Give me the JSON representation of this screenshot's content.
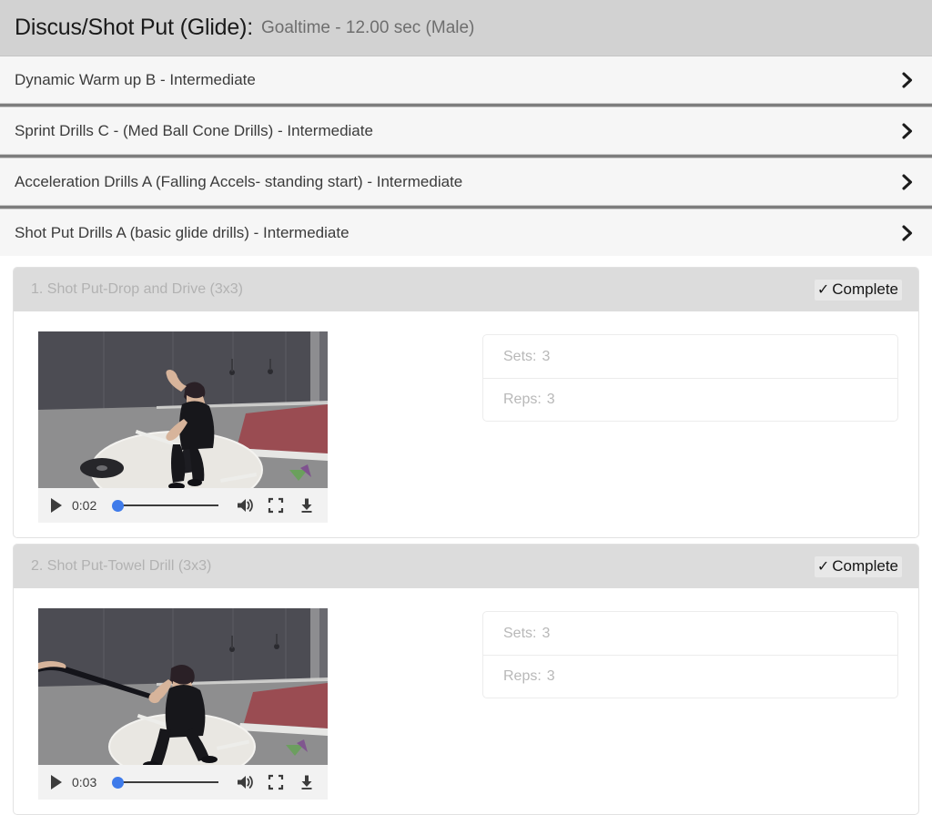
{
  "header": {
    "title": "Discus/Shot Put (Glide):",
    "subtitle": "Goaltime - 12.00 sec (Male)"
  },
  "accordion": {
    "items": [
      {
        "label": "Dynamic Warm up B - Intermediate",
        "icon": "chevron-right-icon"
      },
      {
        "label": "Sprint Drills C - (Med Ball Cone Drills) - Intermediate",
        "icon": "chevron-right-icon"
      },
      {
        "label": "Acceleration Drills A (Falling Accels- standing start) - Intermediate",
        "icon": "chevron-right-icon"
      },
      {
        "label": "Shot Put Drills A (basic glide drills) - Intermediate",
        "icon": "chevron-right-icon"
      }
    ]
  },
  "exercises": [
    {
      "title": "1. Shot Put-Drop and Drive (3x3)",
      "complete_check": "✓",
      "complete_label": "Complete",
      "video": {
        "time": "0:02",
        "play_icon": "play-icon",
        "volume_icon": "volume-icon",
        "fullscreen_icon": "fullscreen-icon",
        "download_icon": "download-icon",
        "progress_percent": 3
      },
      "meta": [
        {
          "label": "Sets:",
          "value": "3"
        },
        {
          "label": "Reps:",
          "value": "3"
        }
      ]
    },
    {
      "title": "2. Shot Put-Towel Drill (3x3)",
      "complete_check": "✓",
      "complete_label": "Complete",
      "video": {
        "time": "0:03",
        "play_icon": "play-icon",
        "volume_icon": "volume-icon",
        "fullscreen_icon": "fullscreen-icon",
        "download_icon": "download-icon",
        "progress_percent": 3
      },
      "meta": [
        {
          "label": "Sets:",
          "value": "3"
        },
        {
          "label": "Reps:",
          "value": "3"
        }
      ]
    }
  ],
  "colors": {
    "header_bg": "#d2d2d2",
    "accordion_bg": "#f6f6f6",
    "separator": "#7d7d7d",
    "card_head_bg": "#dcdcdc",
    "scrubber_knob": "#3f7bea"
  }
}
